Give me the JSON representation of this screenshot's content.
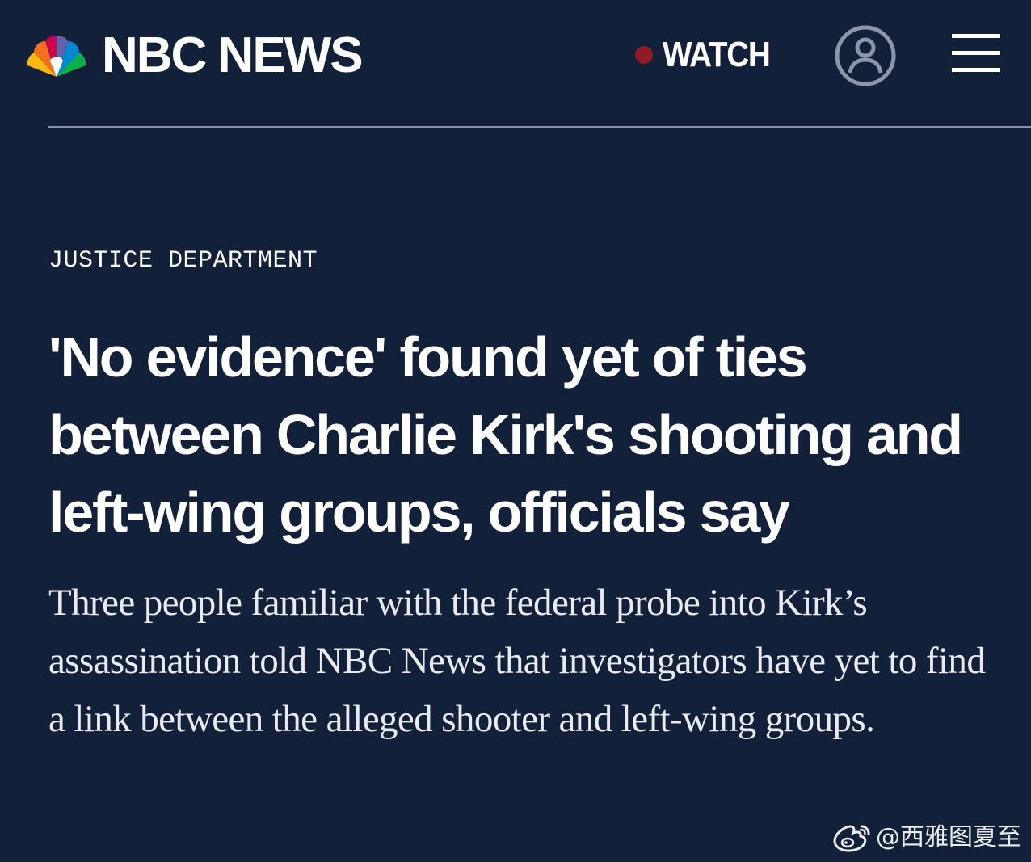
{
  "header": {
    "brand": "NBC NEWS",
    "watch_label": "WATCH",
    "icons": {
      "logo": "nbc-peacock-icon",
      "account": "user-account-icon",
      "menu": "hamburger-menu-icon"
    },
    "live_dot_color": "#8f1d24"
  },
  "article": {
    "section": "JUSTICE DEPARTMENT",
    "headline": "'No evidence' found yet of ties between Charlie Kirk's shooting and left-wing groups, officials say",
    "dek": "Three people familiar with the federal probe into Kirk’s assassination told NBC News that investigators have yet to find a link between the alleged shooter and left-wing groups."
  },
  "watermark": {
    "text": "@西雅图夏至",
    "icon": "weibo-icon"
  },
  "colors": {
    "background": "#12203a",
    "divider": "#8a93a6",
    "text": "#ffffff"
  }
}
